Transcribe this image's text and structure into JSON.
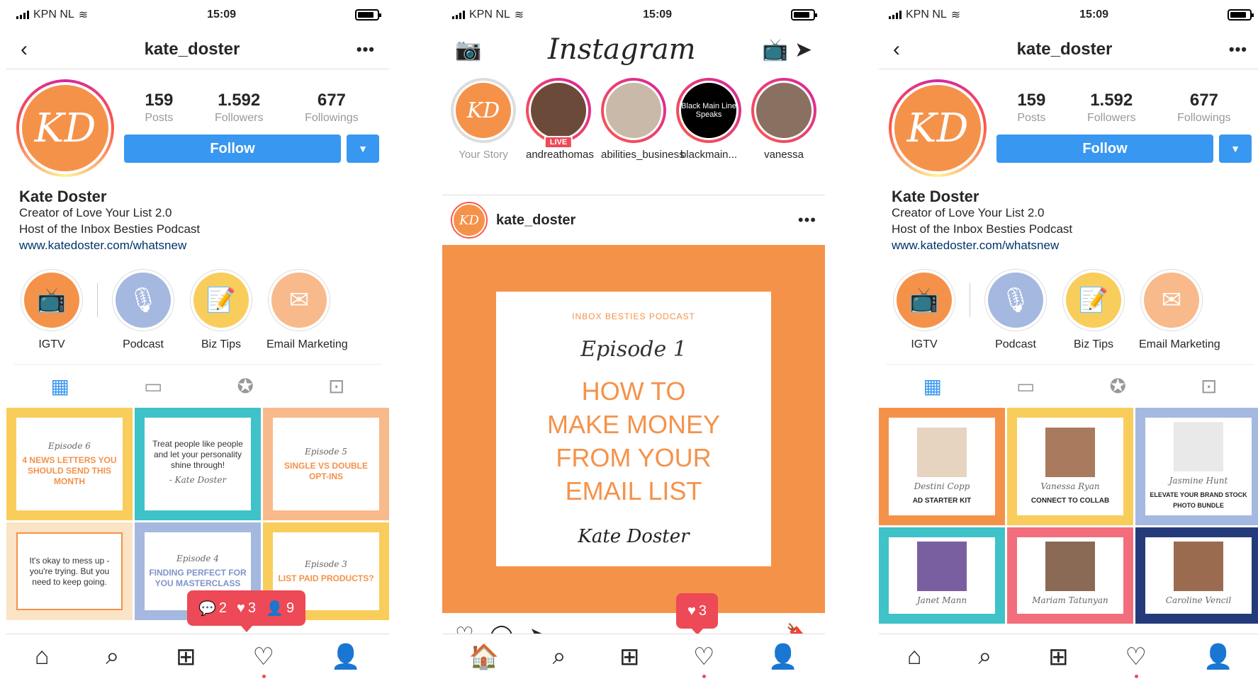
{
  "status": {
    "carrier": "KPN NL",
    "time": "15:09"
  },
  "profile": {
    "username": "kate_doster",
    "avatar_initials": "KD",
    "stats": [
      {
        "num": "159",
        "label": "Posts"
      },
      {
        "num": "1.592",
        "label": "Followers"
      },
      {
        "num": "677",
        "label": "Followings"
      }
    ],
    "follow_label": "Follow",
    "name": "Kate Doster",
    "bio1": "Creator of Love Your List 2.0",
    "bio2": "Host of the Inbox Besties Podcast",
    "link": "www.katedoster.com/whatsnew",
    "highlights": [
      "IGTV",
      "Podcast",
      "Biz Tips",
      "Email Marketing"
    ]
  },
  "grid1": {
    "t1": {
      "ep": "Episode 6",
      "head": "4 NEWS LETTERS YOU SHOULD SEND THIS MONTH"
    },
    "t2": {
      "quote": "Treat people like people and let your personality shine through!",
      "author": "- Kate Doster"
    },
    "t3": {
      "ep": "Episode 5",
      "head": "SINGLE VS DOUBLE OPT-INS"
    },
    "t4": {
      "quote": "It's okay to mess up - you're trying. But you need to keep going."
    },
    "t5": {
      "ep": "Episode 4",
      "head": "FINDING PERFECT FOR YOU MASTERCLASS"
    },
    "t6": {
      "ep": "Episode 3",
      "head": "LIST PAID PRODUCTS?"
    }
  },
  "tooltip1": {
    "comments": "2",
    "likes": "3",
    "follows": "9"
  },
  "feed": {
    "logo": "Instagram",
    "stories": [
      {
        "label": "Your Story"
      },
      {
        "label": "andreathomas",
        "live": "LIVE"
      },
      {
        "label": "abilities_business"
      },
      {
        "label": "blackmain...",
        "inner": "Black Main Line Speaks"
      },
      {
        "label": "vanessa"
      }
    ],
    "post_user": "kate_doster",
    "post": {
      "kicker": "INBOX BESTIES PODCAST",
      "ep": "Episode 1",
      "line1": "HOW TO",
      "line2": "MAKE MONEY",
      "line3": "FROM YOUR",
      "line4": "EMAIL LIST",
      "sig": "Kate Doster"
    },
    "tooltip_likes": "3"
  },
  "grid3": {
    "t1": {
      "sig": "Destini Copp",
      "caption": "AD STARTER KIT"
    },
    "t2": {
      "sig": "Vanessa Ryan",
      "caption": "CONNECT TO COLLAB"
    },
    "t3": {
      "sig": "Jasmine Hunt",
      "caption": "ELEVATE YOUR BRAND STOCK PHOTO BUNDLE"
    },
    "t4": {
      "sig": "Janet Mann"
    },
    "t5": {
      "sig": "Mariam Tatunyan"
    },
    "t6": {
      "sig": "Caroline Vencil"
    }
  },
  "colors": {
    "accent": "#3897f0",
    "orange": "#f5924a",
    "yellow": "#f9cd5b",
    "blue": "#a4b8e0",
    "peach": "#f8b98b",
    "red": "#ed4956",
    "teal": "#3fc2c8",
    "pink": "#f26e7c",
    "navy": "#253a7a"
  }
}
